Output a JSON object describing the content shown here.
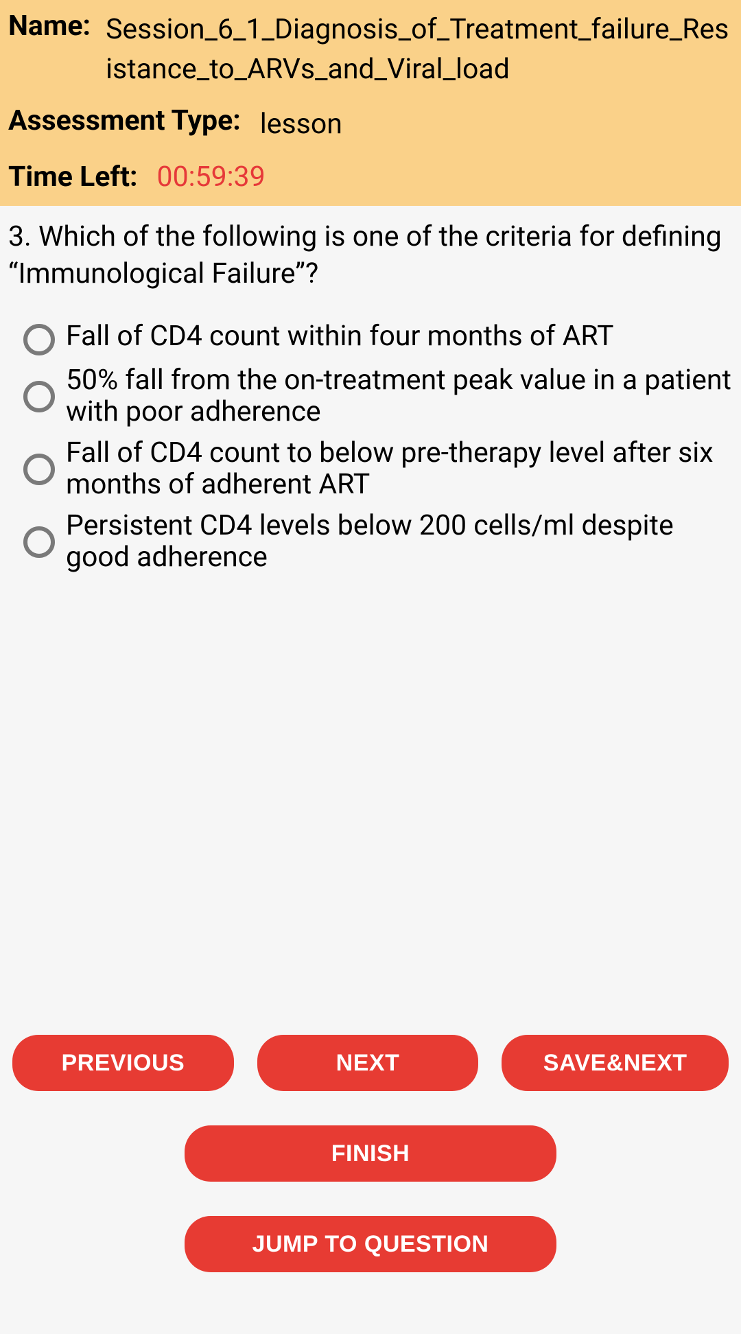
{
  "header": {
    "name_label": "Name:",
    "name_value": "Session_6_1_Diagnosis_of_Treatment_failure_Resistance_to_ARVs_and_Viral_load",
    "assessment_type_label": "Assessment Type:",
    "assessment_type_value": "lesson",
    "time_left_label": "Time Left:",
    "time_left_value": "00:59:39"
  },
  "question": {
    "number": "3.",
    "text": "Which of the following is one of the criteria for defining “Immunological Failure”?",
    "options": [
      "Fall of CD4 count within four months of ART",
      "50% fall from the on-treatment peak value in a patient with poor adherence",
      "Fall of CD4 count to below pre-therapy level after six months of adherent ART",
      "Persistent CD4 levels below 200 cells/ml despite good adherence"
    ]
  },
  "buttons": {
    "previous": "PREVIOUS",
    "next": "NEXT",
    "save_next": "SAVE&NEXT",
    "finish": "FINISH",
    "jump": "JUMP TO QUESTION"
  }
}
